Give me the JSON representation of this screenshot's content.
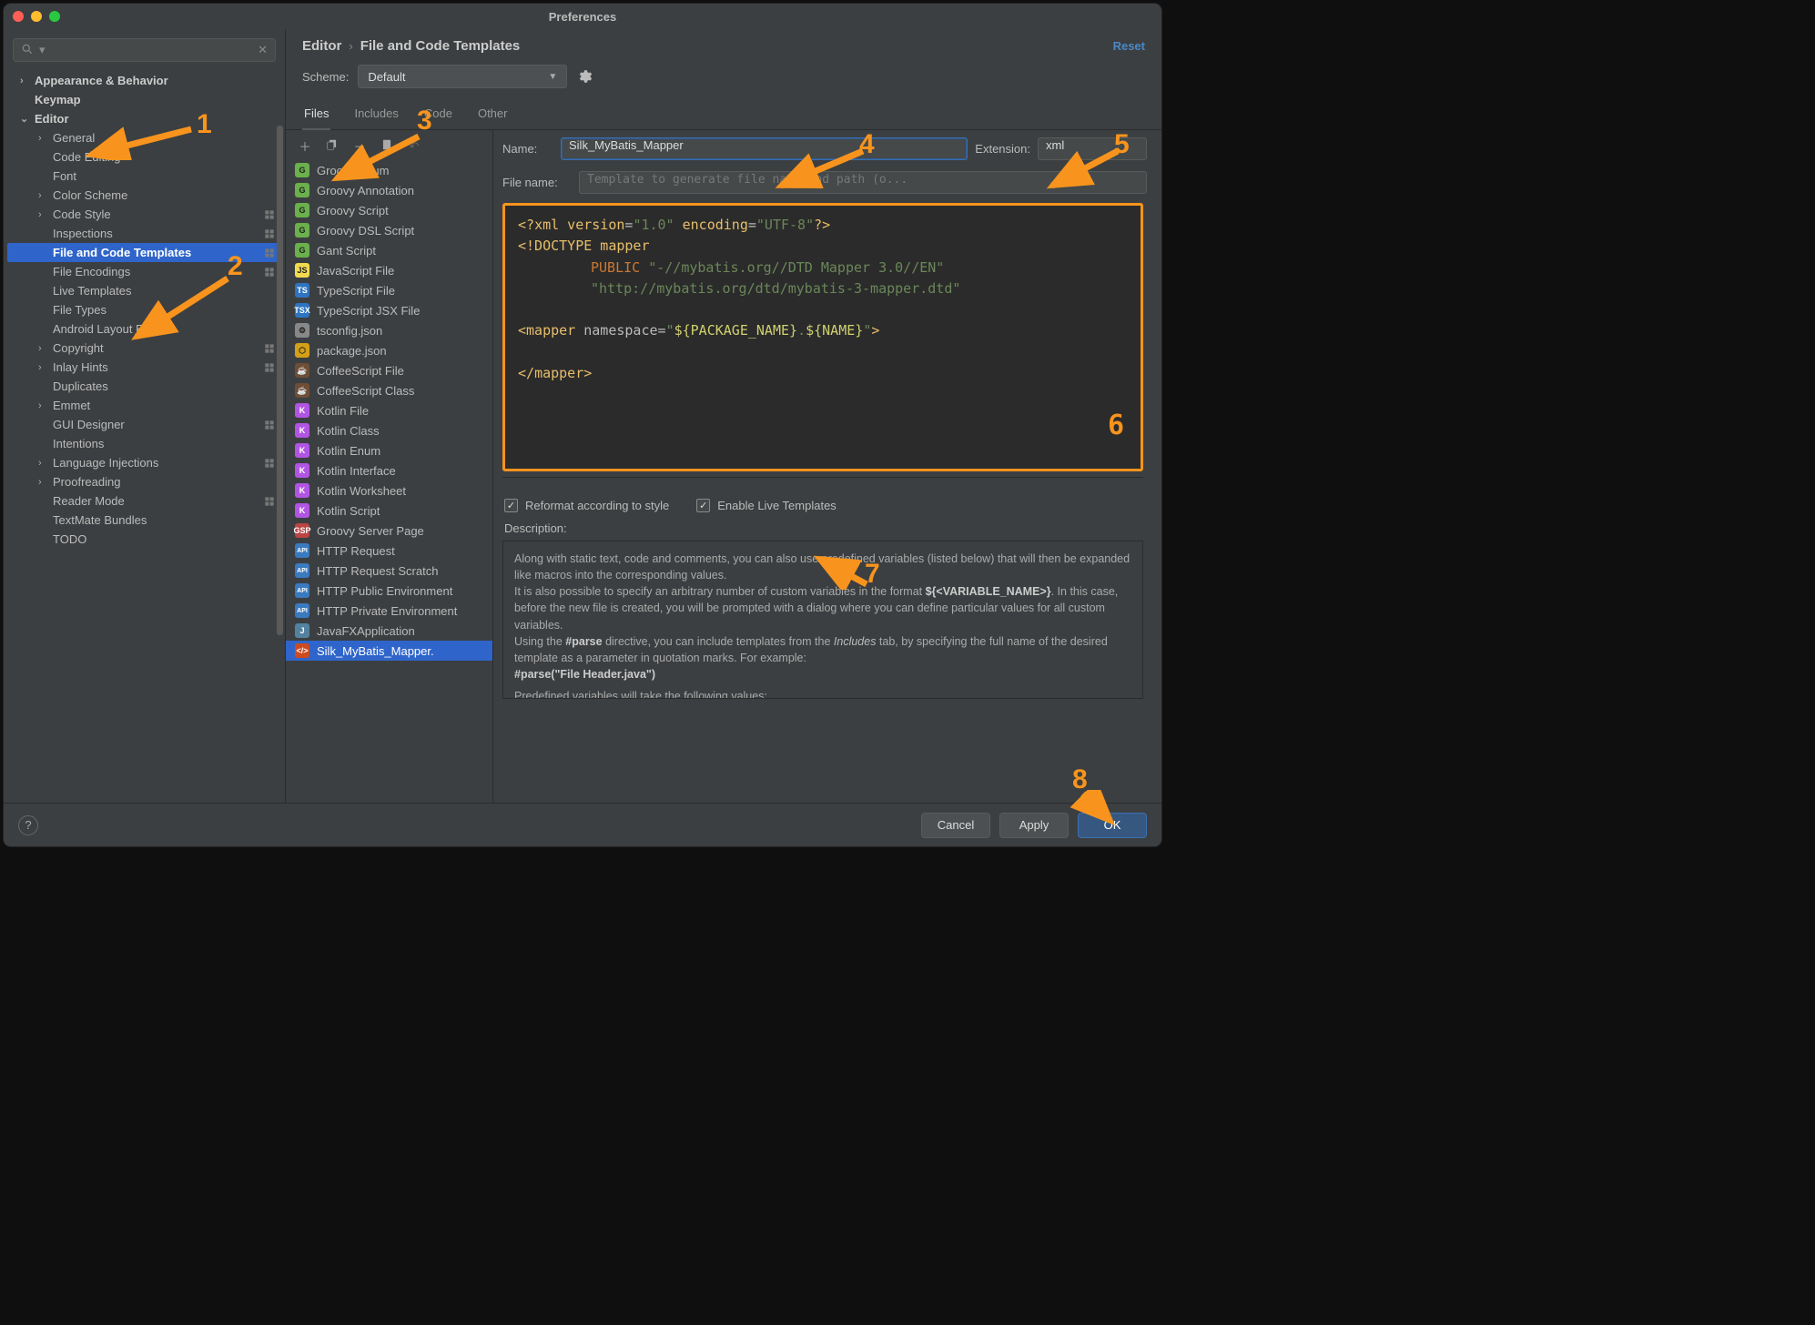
{
  "window_title": "Preferences",
  "search_placeholder": "",
  "tree": [
    {
      "label": "Appearance & Behavior",
      "indent": 0,
      "chev": ">",
      "bold": true
    },
    {
      "label": "Keymap",
      "indent": 0,
      "bold": true
    },
    {
      "label": "Editor",
      "indent": 0,
      "chev": "v",
      "bold": true
    },
    {
      "label": "General",
      "indent": 1,
      "chev": ">"
    },
    {
      "label": "Code Editing",
      "indent": 1
    },
    {
      "label": "Font",
      "indent": 1
    },
    {
      "label": "Color Scheme",
      "indent": 1,
      "chev": ">"
    },
    {
      "label": "Code Style",
      "indent": 1,
      "chev": ">",
      "cfg": true
    },
    {
      "label": "Inspections",
      "indent": 1,
      "cfg": true
    },
    {
      "label": "File and Code Templates",
      "indent": 1,
      "selected": true,
      "cfg": true
    },
    {
      "label": "File Encodings",
      "indent": 1,
      "cfg": true
    },
    {
      "label": "Live Templates",
      "indent": 1
    },
    {
      "label": "File Types",
      "indent": 1
    },
    {
      "label": "Android Layout Editor",
      "indent": 1
    },
    {
      "label": "Copyright",
      "indent": 1,
      "chev": ">",
      "cfg": true
    },
    {
      "label": "Inlay Hints",
      "indent": 1,
      "chev": ">",
      "cfg": true
    },
    {
      "label": "Duplicates",
      "indent": 1
    },
    {
      "label": "Emmet",
      "indent": 1,
      "chev": ">"
    },
    {
      "label": "GUI Designer",
      "indent": 1,
      "cfg": true
    },
    {
      "label": "Intentions",
      "indent": 1
    },
    {
      "label": "Language Injections",
      "indent": 1,
      "chev": ">",
      "cfg": true
    },
    {
      "label": "Proofreading",
      "indent": 1,
      "chev": ">"
    },
    {
      "label": "Reader Mode",
      "indent": 1,
      "cfg": true
    },
    {
      "label": "TextMate Bundles",
      "indent": 1
    },
    {
      "label": "TODO",
      "indent": 1
    }
  ],
  "breadcrumb": {
    "a": "Editor",
    "b": "File and Code Templates"
  },
  "reset_label": "Reset",
  "scheme_label": "Scheme:",
  "scheme_value": "Default",
  "tabs": [
    "Files",
    "Includes",
    "Code",
    "Other"
  ],
  "active_tab": 0,
  "templates": [
    {
      "label": "Groovy Enum",
      "ico": "green",
      "t": "G"
    },
    {
      "label": "Groovy Annotation",
      "ico": "green",
      "t": "G"
    },
    {
      "label": "Groovy Script",
      "ico": "green",
      "t": "G"
    },
    {
      "label": "Groovy DSL Script",
      "ico": "green",
      "t": "G"
    },
    {
      "label": "Gant Script",
      "ico": "green",
      "t": "G"
    },
    {
      "label": "JavaScript File",
      "ico": "js",
      "t": "JS"
    },
    {
      "label": "TypeScript File",
      "ico": "ts",
      "t": "TS"
    },
    {
      "label": "TypeScript JSX File",
      "ico": "tsx",
      "t": "TSX"
    },
    {
      "label": "tsconfig.json",
      "ico": "gear",
      "t": "⚙"
    },
    {
      "label": "package.json",
      "ico": "yellow",
      "t": "⬡"
    },
    {
      "label": "CoffeeScript File",
      "ico": "coffee",
      "t": "☕"
    },
    {
      "label": "CoffeeScript Class",
      "ico": "coffee",
      "t": "☕"
    },
    {
      "label": "Kotlin File",
      "ico": "kotlin",
      "t": "K"
    },
    {
      "label": "Kotlin Class",
      "ico": "kotlin",
      "t": "K"
    },
    {
      "label": "Kotlin Enum",
      "ico": "kotlin",
      "t": "K"
    },
    {
      "label": "Kotlin Interface",
      "ico": "kotlin",
      "t": "K"
    },
    {
      "label": "Kotlin Worksheet",
      "ico": "kotlin",
      "t": "K"
    },
    {
      "label": "Kotlin Script",
      "ico": "kotlin",
      "t": "K"
    },
    {
      "label": "Groovy Server Page",
      "ico": "gsp",
      "t": "GSP"
    },
    {
      "label": "HTTP Request",
      "ico": "api",
      "t": "API"
    },
    {
      "label": "HTTP Request Scratch",
      "ico": "api",
      "t": "API"
    },
    {
      "label": "HTTP Public Environment",
      "ico": "api",
      "t": "API"
    },
    {
      "label": "HTTP Private Environment",
      "ico": "api",
      "t": "API"
    },
    {
      "label": "JavaFXApplication",
      "ico": "java",
      "t": "J"
    },
    {
      "label": "Silk_MyBatis_Mapper.",
      "ico": "code",
      "t": "</>",
      "selected": true
    }
  ],
  "name_label": "Name:",
  "name_value": "Silk_MyBatis_Mapper",
  "ext_label": "Extension:",
  "ext_value": "xml",
  "filename_label": "File name:",
  "filename_placeholder": "Template to generate file name and path (o...",
  "code_lines": {
    "l1_a": "<?",
    "l1_b": "xml version",
    "l1_c": "=",
    "l1_d": "\"1.0\"",
    "l1_e": " encoding",
    "l1_f": "=",
    "l1_g": "\"UTF-8\"",
    "l1_h": "?>",
    "l2": "<!DOCTYPE mapper",
    "l3_a": "PUBLIC ",
    "l3_b": "\"-//mybatis.org//DTD Mapper 3.0//EN\"",
    "l4": "\"http://mybatis.org/dtd/mybatis-3-mapper.dtd\"",
    "l5_a": "<",
    "l5_b": "mapper ",
    "l5_c": "namespace",
    "l5_d": "=",
    "l5_e": "\"",
    "l5_f": "${",
    "l5_g": "PACKAGE_NAME",
    "l5_h": "}",
    "l5_i": ".",
    "l5_j": "${",
    "l5_k": "NAME",
    "l5_l": "}",
    "l5_m": "\"",
    "l5_n": ">",
    "l6_a": "</",
    "l6_b": "mapper",
    "l6_c": ">"
  },
  "check1": "Reformat according to style",
  "check2": "Enable Live Templates",
  "desc_label": "Description:",
  "desc": {
    "p1": "Along with static text, code and comments, you can also use predefined variables (listed below) that will then be expanded like macros into the corresponding values.",
    "p2a": "It is also possible to specify an arbitrary number of custom variables in the format ",
    "p2b": "${<VARIABLE_NAME>}",
    "p2c": ". In this case, before the new file is created, you will be prompted with a dialog where you can define particular values for all custom variables.",
    "p3a": "Using the ",
    "p3b": "#parse",
    "p3c": " directive, you can include templates from the ",
    "p3d": "Includes",
    "p3e": " tab, by specifying the full name of the desired template as a parameter in quotation marks. For example:",
    "p4": "#parse(\"File Header.java\")",
    "p5": "Predefined variables will take the following values:"
  },
  "buttons": {
    "cancel": "Cancel",
    "apply": "Apply",
    "ok": "OK"
  },
  "annotations": {
    "1": "1",
    "2": "2",
    "3": "3",
    "4": "4",
    "5": "5",
    "6": "6",
    "7": "7",
    "8": "8"
  }
}
